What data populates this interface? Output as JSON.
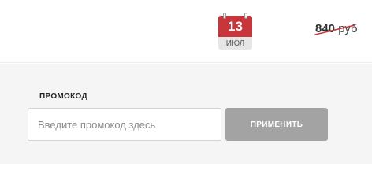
{
  "date_badge": {
    "day": "13",
    "month": "ИЮЛ"
  },
  "price": {
    "old_value": "840",
    "currency": "руб",
    "strike_color": "#c8363c"
  },
  "promo": {
    "label": "ПРОМОКОД",
    "placeholder": "Введите промокод здесь",
    "value": "",
    "apply_label": "ПРИМЕНИТЬ"
  },
  "colors": {
    "accent": "#c8363c",
    "button_disabled": "#a3a3a3",
    "panel_background": "#f5f5f5"
  }
}
